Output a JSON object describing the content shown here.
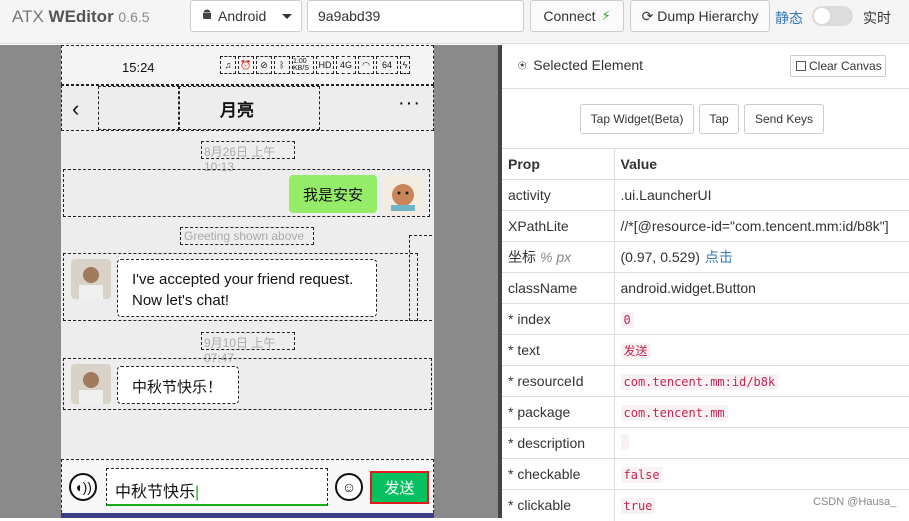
{
  "app": {
    "name_light": "ATX ",
    "name_bold": "WEditor",
    "version": "0.6.5"
  },
  "toolbar": {
    "platform": "Android",
    "serial": "9a9abd39",
    "connect_label": "Connect",
    "dump_label": "Dump Hierarchy",
    "mode_static": "静态",
    "mode_live": "实时"
  },
  "phone": {
    "status_time": "15:24",
    "status_icons": [
      "headphones",
      "alarm",
      "mute",
      "bluetooth",
      "1.00 KB/S",
      "HD",
      "4G",
      "wifi",
      "64",
      "charging"
    ],
    "chat_title": "月亮",
    "timestamps": [
      "8月26日 上午10:13",
      "9月10日 上午07:47"
    ],
    "msg_out": "我是安安",
    "greeting_note": "Greeting shown above",
    "msg_in_1": "I've accepted your friend request. Now let's chat!",
    "msg_in_2": "中秋节快乐！",
    "input_value": "中秋节快乐",
    "send_label": "发送"
  },
  "panel": {
    "title": "Selected Element",
    "clear_canvas": "Clear Canvas",
    "buttons": {
      "tap_widget": "Tap Widget(Beta)",
      "tap": "Tap",
      "send_keys": "Send Keys"
    },
    "headers": {
      "prop": "Prop",
      "value": "Value"
    },
    "rows": [
      {
        "prop": "activity",
        "value": ".ui.LauncherUI",
        "style": "plain"
      },
      {
        "prop": "XPathLite",
        "value": "//*[@resource-id=\"com.tencent.mm:id/b8k\"]",
        "style": "plain"
      },
      {
        "prop": "坐标",
        "value": "(0.97, 0.529)",
        "style": "coord"
      },
      {
        "prop": "className",
        "value": "android.widget.Button",
        "style": "plain"
      },
      {
        "prop": "* index",
        "value": "0",
        "style": "code"
      },
      {
        "prop": "* text",
        "value": "发送",
        "style": "code"
      },
      {
        "prop": "* resourceId",
        "value": "com.tencent.mm:id/b8k",
        "style": "code"
      },
      {
        "prop": "* package",
        "value": "com.tencent.mm",
        "style": "code"
      },
      {
        "prop": "* description",
        "value": "",
        "style": "code"
      },
      {
        "prop": "* checkable",
        "value": "false",
        "style": "code"
      },
      {
        "prop": "* clickable",
        "value": "true",
        "style": "code"
      }
    ],
    "coord_units": "% px",
    "coord_link": "点击"
  },
  "watermark": "CSDN @Hausa_"
}
